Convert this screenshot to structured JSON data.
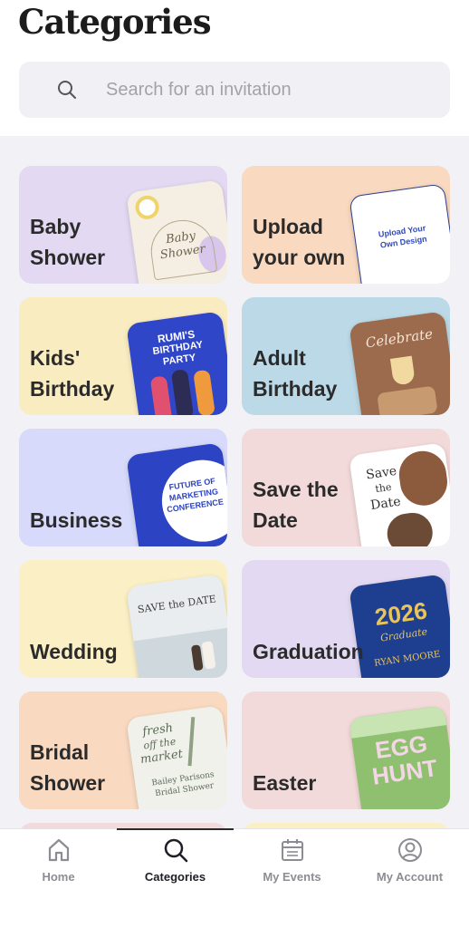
{
  "header": {
    "title": "Categories"
  },
  "search": {
    "placeholder": "Search for an invitation",
    "icon": "search-icon"
  },
  "categories": [
    {
      "label": "Baby\nShower",
      "color": "#e3d9f2",
      "thumb_texts": [
        "Baby",
        "Shower"
      ]
    },
    {
      "label": "Upload\nyour own",
      "color": "#f9d9c0",
      "thumb_texts": [
        "Upload Your",
        "Own Design"
      ]
    },
    {
      "label": "Kids'\nBirthday",
      "color": "#f9ecc1",
      "thumb_texts": [
        "RUMI'S",
        "BIRTHDAY",
        "PARTY"
      ]
    },
    {
      "label": "Adult\nBirthday",
      "color": "#bcd9e7",
      "thumb_texts": [
        "Celebrate"
      ]
    },
    {
      "label": "Business",
      "color": "#d7dafa",
      "thumb_texts": [
        "FUTURE OF",
        "MARKETING",
        "CONFERENCE"
      ]
    },
    {
      "label": "Save the\nDate",
      "color": "#f3dada",
      "thumb_texts": [
        "Save",
        "the",
        "Date"
      ]
    },
    {
      "label": "Wedding",
      "color": "#fbf0c5",
      "thumb_texts": [
        "SAVE the DATE"
      ]
    },
    {
      "label": "Graduation",
      "color": "#e3d9f2",
      "thumb_texts": [
        "2026",
        "Graduate",
        "RYAN MOORE"
      ]
    },
    {
      "label": "Bridal\nShower",
      "color": "#f9d9c0",
      "thumb_texts": [
        "fresh",
        "off the",
        "market",
        "Bailey Parisons",
        "Bridal Shower"
      ]
    },
    {
      "label": "Easter",
      "color": "#f3dada",
      "thumb_texts": [
        "EGG",
        "HUNT"
      ]
    }
  ],
  "tabs": [
    {
      "label": "Home",
      "icon": "home-icon",
      "active": false
    },
    {
      "label": "Categories",
      "icon": "search-icon",
      "active": true
    },
    {
      "label": "My Events",
      "icon": "calendar-icon",
      "active": false
    },
    {
      "label": "My Account",
      "icon": "account-icon",
      "active": false
    }
  ]
}
